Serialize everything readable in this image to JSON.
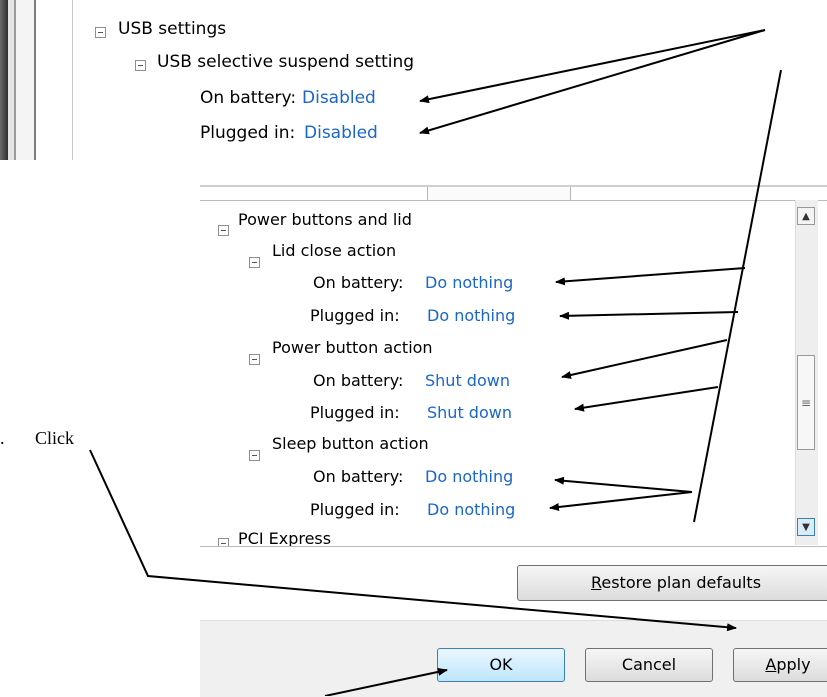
{
  "top_panel": {
    "usb_settings": "USB settings",
    "usb_selective": "USB selective suspend setting",
    "on_battery_label": "On battery:",
    "on_battery_value": "Disabled",
    "plugged_in_label": "Plugged in:",
    "plugged_in_value": "Disabled"
  },
  "list": {
    "power_buttons": "Power buttons and lid",
    "lid_close": "Lid close action",
    "lid_battery_label": "On battery:",
    "lid_battery_value": "Do nothing",
    "lid_plugged_label": "Plugged in:",
    "lid_plugged_value": "Do nothing",
    "power_button": "Power button action",
    "pb_battery_label": "On battery:",
    "pb_battery_value": "Shut down",
    "pb_plugged_label": "Plugged in:",
    "pb_plugged_value": "Shut down",
    "sleep_button": "Sleep button action",
    "sb_battery_label": "On battery:",
    "sb_battery_value": "Do nothing",
    "sb_plugged_label": "Plugged in:",
    "sb_plugged_value": "Do nothing",
    "pci_express": "PCI Express"
  },
  "buttons": {
    "restore_prefix": "",
    "restore_mnemonic": "R",
    "restore_rest": "estore plan defaults",
    "ok": "OK",
    "cancel": "Cancel",
    "apply_mnemonic": "A",
    "apply_rest": "pply"
  },
  "annotation": {
    "dot": ".",
    "click": "Click"
  },
  "colors": {
    "link": "#1a66c9",
    "ok_button": "#bee6fd"
  }
}
